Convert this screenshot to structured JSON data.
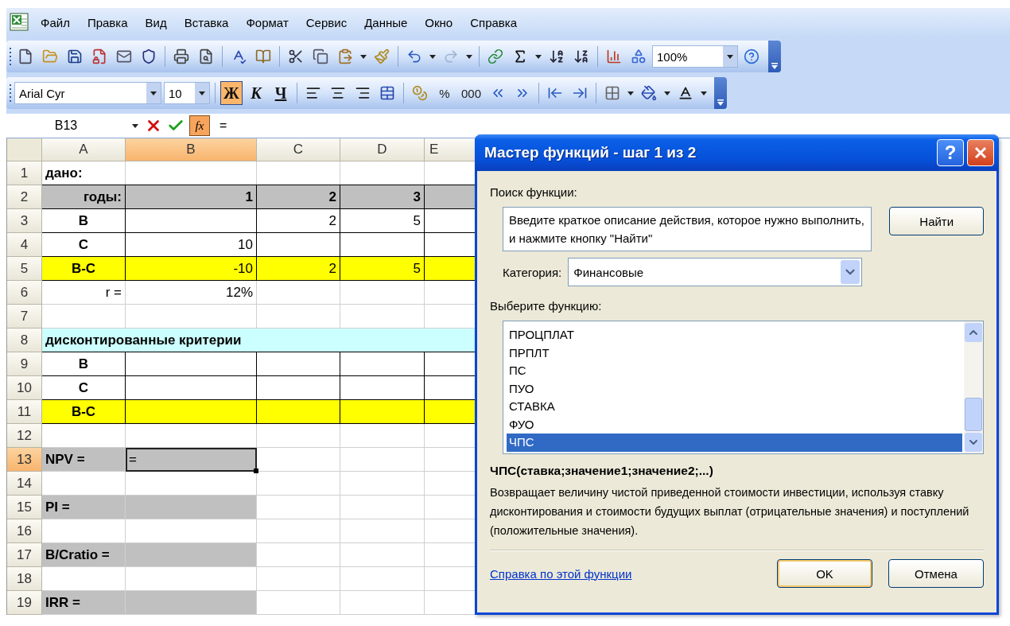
{
  "menu": [
    "Файл",
    "Правка",
    "Вид",
    "Вставка",
    "Формат",
    "Сервис",
    "Данные",
    "Окно",
    "Справка"
  ],
  "toolbar_standard": {
    "redo": {
      "disabled": true
    },
    "zoom": "100%"
  },
  "toolbar_formatting": {
    "font": "Arial Cyr",
    "size": "10",
    "style_buttons": [
      {
        "label": "Ж",
        "selected": true
      },
      {
        "label": "К",
        "selected": false
      },
      {
        "label": "Ч",
        "selected": false
      }
    ],
    "number_buttons": [
      "%",
      "000"
    ]
  },
  "formula_bar": {
    "name_box": "B13",
    "function_button": "fx",
    "formula": "="
  },
  "sheet": {
    "columns": [
      {
        "label": "A",
        "selected": false
      },
      {
        "label": "B",
        "selected": true
      },
      {
        "label": "C",
        "selected": false
      },
      {
        "label": "D",
        "selected": false
      },
      {
        "label": "E",
        "selected": false
      }
    ],
    "rows": [
      {
        "number": "1",
        "selected": false,
        "kind": "plain",
        "cells": [
          {
            "text": "дано:",
            "kind": "text",
            "bold": true
          },
          {},
          {},
          {},
          {}
        ]
      },
      {
        "number": "2",
        "selected": false,
        "kind": "bordered",
        "cells": [
          {
            "text": "годы:",
            "bold": true,
            "kind": "number",
            "color": "#c0c0c0"
          },
          {
            "text": "1",
            "bold": true,
            "kind": "number",
            "color": "#c0c0c0"
          },
          {
            "text": "2",
            "bold": true,
            "kind": "number",
            "color": "#c0c0c0"
          },
          {
            "text": "3",
            "bold": true,
            "kind": "number",
            "color": "#c0c0c0"
          },
          {
            "color": "#c0c0c0"
          }
        ]
      },
      {
        "number": "3",
        "selected": false,
        "kind": "bordered",
        "cells": [
          {
            "text": "B",
            "bold": true,
            "kind": "code"
          },
          {},
          {
            "text": "2",
            "kind": "number"
          },
          {
            "text": "5",
            "kind": "number"
          },
          {}
        ]
      },
      {
        "number": "4",
        "selected": false,
        "kind": "bordered",
        "cells": [
          {
            "text": "C",
            "bold": true,
            "kind": "code"
          },
          {
            "text": "10",
            "kind": "number"
          },
          {},
          {},
          {}
        ]
      },
      {
        "number": "5",
        "selected": false,
        "kind": "bordered",
        "cells": [
          {
            "text": "B-C",
            "bold": true,
            "kind": "code",
            "color": "#ffff00"
          },
          {
            "text": "-10",
            "kind": "number",
            "color": "#ffff00"
          },
          {
            "text": "2",
            "kind": "number",
            "color": "#ffff00"
          },
          {
            "text": "5",
            "kind": "number",
            "color": "#ffff00"
          },
          {
            "color": "#ffff00"
          }
        ]
      },
      {
        "number": "6",
        "selected": false,
        "kind": "plain",
        "cells": [
          {
            "text": "r =",
            "kind": "number"
          },
          {
            "text": "12%",
            "kind": "number"
          },
          {},
          {},
          {}
        ]
      },
      {
        "number": "7",
        "selected": false,
        "kind": "plain",
        "cells": [
          {},
          {},
          {},
          {},
          {}
        ]
      },
      {
        "number": "8",
        "selected": false,
        "kind": "section",
        "cells": [
          {
            "text": "дисконтированные критерии",
            "kind": "text",
            "bold": true,
            "color": "#ccffff"
          }
        ]
      },
      {
        "number": "9",
        "selected": false,
        "kind": "bordered",
        "cells": [
          {
            "text": "B",
            "bold": true,
            "kind": "code"
          },
          {},
          {},
          {},
          {}
        ]
      },
      {
        "number": "10",
        "selected": false,
        "kind": "bordered",
        "cells": [
          {
            "text": "C",
            "bold": true,
            "kind": "code"
          },
          {},
          {},
          {},
          {}
        ]
      },
      {
        "number": "11",
        "selected": false,
        "kind": "bordered",
        "cells": [
          {
            "text": "B-C",
            "bold": true,
            "kind": "code",
            "color": "#ffff00"
          },
          {
            "color": "#ffff00"
          },
          {
            "color": "#ffff00"
          },
          {
            "color": "#ffff00"
          },
          {
            "color": "#ffff00"
          }
        ]
      },
      {
        "number": "12",
        "selected": false,
        "kind": "plain",
        "cells": [
          {},
          {},
          {},
          {},
          {}
        ]
      },
      {
        "number": "13",
        "selected": true,
        "kind": "plain",
        "cells": [
          {
            "text": "NPV =",
            "kind": "text",
            "bold": true,
            "color": "#c0c0c0"
          },
          {
            "text": "=",
            "kind": "text",
            "color": "#c0c0c0"
          },
          {},
          {},
          {}
        ]
      },
      {
        "number": "14",
        "selected": false,
        "kind": "plain",
        "cells": [
          {},
          {},
          {},
          {},
          {}
        ]
      },
      {
        "number": "15",
        "selected": false,
        "kind": "plain",
        "cells": [
          {
            "text": "PI =",
            "kind": "text",
            "bold": true,
            "color": "#c0c0c0"
          },
          {
            "color": "#c0c0c0"
          },
          {},
          {},
          {}
        ]
      },
      {
        "number": "16",
        "selected": false,
        "kind": "plain",
        "cells": [
          {},
          {},
          {},
          {},
          {}
        ]
      },
      {
        "number": "17",
        "selected": false,
        "kind": "plain",
        "cells": [
          {
            "text": "B/Cratio =",
            "kind": "text",
            "bold": true,
            "color": "#c0c0c0"
          },
          {
            "color": "#c0c0c0"
          },
          {},
          {},
          {}
        ]
      },
      {
        "number": "18",
        "selected": false,
        "kind": "plain",
        "cells": [
          {},
          {},
          {},
          {},
          {}
        ]
      },
      {
        "number": "19",
        "selected": false,
        "kind": "plain",
        "cells": [
          {
            "text": "IRR =",
            "kind": "text",
            "bold": true,
            "color": "#c0c0c0"
          },
          {
            "color": "#c0c0c0"
          },
          {},
          {},
          {}
        ]
      }
    ]
  },
  "dialog": {
    "title": "Мастер функций - шаг 1 из 2",
    "help_button": "?",
    "search_label": "Поиск функции:",
    "search_value": "Введите краткое описание действия, которое нужно выполнить, и нажмите кнопку \"Найти\"",
    "find_button": "Найти",
    "category_label": "Категория:",
    "category_value": "Финансовые",
    "list_label": "Выберите функцию:",
    "functions": [
      {
        "label": "ПРОЦПЛАТ",
        "selected": false
      },
      {
        "label": "ПРПЛТ",
        "selected": false
      },
      {
        "label": "ПС",
        "selected": false
      },
      {
        "label": "ПУО",
        "selected": false
      },
      {
        "label": "СТАВКА",
        "selected": false
      },
      {
        "label": "ФУО",
        "selected": false
      },
      {
        "label": "ЧПС",
        "selected": true
      }
    ],
    "signature": "ЧПС(ставка;значение1;значение2;...)",
    "description": "Возвращает величину чистой приведенной стоимости инвестиции, используя ставку дисконтирования и стоимости будущих выплат (отрицательные значения) и поступлений (положительные значения).",
    "help_link": "Справка по этой функции",
    "ok_button": "OK",
    "cancel_button": "Отмена"
  }
}
